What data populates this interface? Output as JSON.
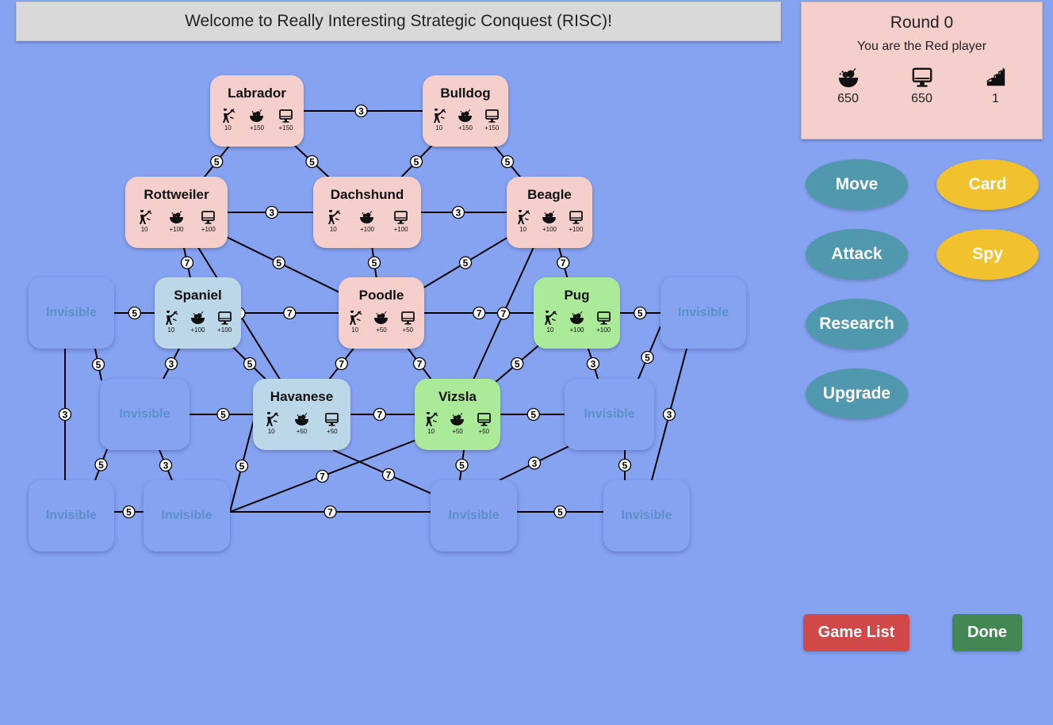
{
  "welcome": "Welcome to Really Interesting Strategic Conquest (RISC)!",
  "colors": {
    "background": "#86a3f2",
    "red_player": "#f5cfcc",
    "blue_player": "#bcd7e8",
    "green_player": "#aaea98",
    "invisible_text": "#5b8fc9",
    "button_teal": "#4f98ad",
    "button_gold": "#f2c12e",
    "game_list_red": "#d04848",
    "done_green": "#438854"
  },
  "panel": {
    "round": "Round 0",
    "player": "You are the Red player",
    "resources": [
      {
        "icon": "food-bowl-icon",
        "value": "650"
      },
      {
        "icon": "computer-monitor-icon",
        "value": "650"
      },
      {
        "icon": "tech-level-stairs-icon",
        "value": "1"
      }
    ]
  },
  "buttons": {
    "move": "Move",
    "card": "Card",
    "attack": "Attack",
    "spy": "Spy",
    "research": "Research",
    "upgrade": "Upgrade",
    "game_list": "Game List",
    "done": "Done"
  },
  "territories": [
    {
      "id": "labrador",
      "name": "Labrador",
      "owner": "red",
      "units": "10",
      "food": "+150",
      "tech": "+150"
    },
    {
      "id": "bulldog",
      "name": "Bulldog",
      "owner": "red",
      "units": "10",
      "food": "+150",
      "tech": "+150"
    },
    {
      "id": "rottweiler",
      "name": "Rottweiler",
      "owner": "red",
      "units": "10",
      "food": "+100",
      "tech": "+100"
    },
    {
      "id": "dachshund",
      "name": "Dachshund",
      "owner": "red",
      "units": "10",
      "food": "+100",
      "tech": "+100"
    },
    {
      "id": "beagle",
      "name": "Beagle",
      "owner": "red",
      "units": "10",
      "food": "+100",
      "tech": "+100"
    },
    {
      "id": "spaniel",
      "name": "Spaniel",
      "owner": "blue",
      "units": "10",
      "food": "+100",
      "tech": "+100"
    },
    {
      "id": "poodle",
      "name": "Poodle",
      "owner": "red",
      "units": "10",
      "food": "+50",
      "tech": "+50"
    },
    {
      "id": "pug",
      "name": "Pug",
      "owner": "green",
      "units": "10",
      "food": "+100",
      "tech": "+100"
    },
    {
      "id": "havanese",
      "name": "Havanese",
      "owner": "blue",
      "units": "10",
      "food": "+50",
      "tech": "+50"
    },
    {
      "id": "vizsla",
      "name": "Vizsla",
      "owner": "green",
      "units": "10",
      "food": "+50",
      "tech": "+50"
    },
    {
      "id": "inv1",
      "name": "Invisible",
      "owner": "hidden"
    },
    {
      "id": "inv2",
      "name": "Invisible",
      "owner": "hidden"
    },
    {
      "id": "inv3",
      "name": "Invisible",
      "owner": "hidden"
    },
    {
      "id": "inv4",
      "name": "Invisible",
      "owner": "hidden"
    },
    {
      "id": "inv5",
      "name": "Invisible",
      "owner": "hidden"
    },
    {
      "id": "inv6",
      "name": "Invisible",
      "owner": "hidden"
    },
    {
      "id": "inv7",
      "name": "Invisible",
      "owner": "hidden"
    },
    {
      "id": "inv8",
      "name": "Invisible",
      "owner": "hidden"
    }
  ],
  "edges": [
    {
      "from": "labrador",
      "to": "bulldog",
      "cost": "3"
    },
    {
      "from": "labrador",
      "to": "rottweiler",
      "cost": "5"
    },
    {
      "from": "labrador",
      "to": "dachshund",
      "cost": "5"
    },
    {
      "from": "bulldog",
      "to": "dachshund",
      "cost": "5"
    },
    {
      "from": "bulldog",
      "to": "beagle",
      "cost": "5"
    },
    {
      "from": "rottweiler",
      "to": "dachshund",
      "cost": "3"
    },
    {
      "from": "dachshund",
      "to": "beagle",
      "cost": "3"
    },
    {
      "from": "rottweiler",
      "to": "spaniel",
      "cost": "7"
    },
    {
      "from": "rottweiler",
      "to": "poodle",
      "cost": "5"
    },
    {
      "from": "dachshund",
      "to": "poodle",
      "cost": "5"
    },
    {
      "from": "beagle",
      "to": "poodle",
      "cost": "5"
    },
    {
      "from": "beagle",
      "to": "pug",
      "cost": "7"
    },
    {
      "from": "beagle",
      "to": "vizsla",
      "cost": "7"
    },
    {
      "from": "rottweiler",
      "to": "havanese",
      "cost": "7"
    },
    {
      "from": "spaniel",
      "to": "poodle",
      "cost": "7"
    },
    {
      "from": "poodle",
      "to": "pug",
      "cost": "7"
    },
    {
      "from": "inv1",
      "to": "spaniel",
      "cost": "5"
    },
    {
      "from": "pug",
      "to": "inv8",
      "cost": "5"
    },
    {
      "from": "spaniel",
      "to": "inv2",
      "cost": "3"
    },
    {
      "from": "spaniel",
      "to": "havanese",
      "cost": "5"
    },
    {
      "from": "poodle",
      "to": "havanese",
      "cost": "7"
    },
    {
      "from": "poodle",
      "to": "vizsla",
      "cost": "7"
    },
    {
      "from": "pug",
      "to": "vizsla",
      "cost": "5"
    },
    {
      "from": "pug",
      "to": "inv3",
      "cost": "3"
    },
    {
      "from": "inv1",
      "to": "inv2",
      "cost": "5"
    },
    {
      "from": "inv1",
      "to": "inv4",
      "cost": "3"
    },
    {
      "from": "inv8",
      "to": "inv3",
      "cost": "5"
    },
    {
      "from": "inv8",
      "to": "inv7",
      "cost": "3"
    },
    {
      "from": "inv2",
      "to": "havanese",
      "cost": "5"
    },
    {
      "from": "havanese",
      "to": "vizsla",
      "cost": "7"
    },
    {
      "from": "vizsla",
      "to": "inv3",
      "cost": "5"
    },
    {
      "from": "inv2",
      "to": "inv4",
      "cost": "5"
    },
    {
      "from": "inv2",
      "to": "inv5",
      "cost": "3"
    },
    {
      "from": "havanese",
      "to": "inv5",
      "cost": "5"
    },
    {
      "from": "havanese",
      "to": "inv6",
      "cost": "7"
    },
    {
      "from": "vizsla",
      "to": "inv5",
      "cost": "7"
    },
    {
      "from": "vizsla",
      "to": "inv6",
      "cost": "5"
    },
    {
      "from": "inv3",
      "to": "inv6",
      "cost": "3"
    },
    {
      "from": "inv3",
      "to": "inv7",
      "cost": "5"
    },
    {
      "from": "inv4",
      "to": "inv5",
      "cost": "5"
    },
    {
      "from": "inv5",
      "to": "inv6",
      "cost": "7"
    },
    {
      "from": "inv6",
      "to": "inv7",
      "cost": "5"
    }
  ]
}
